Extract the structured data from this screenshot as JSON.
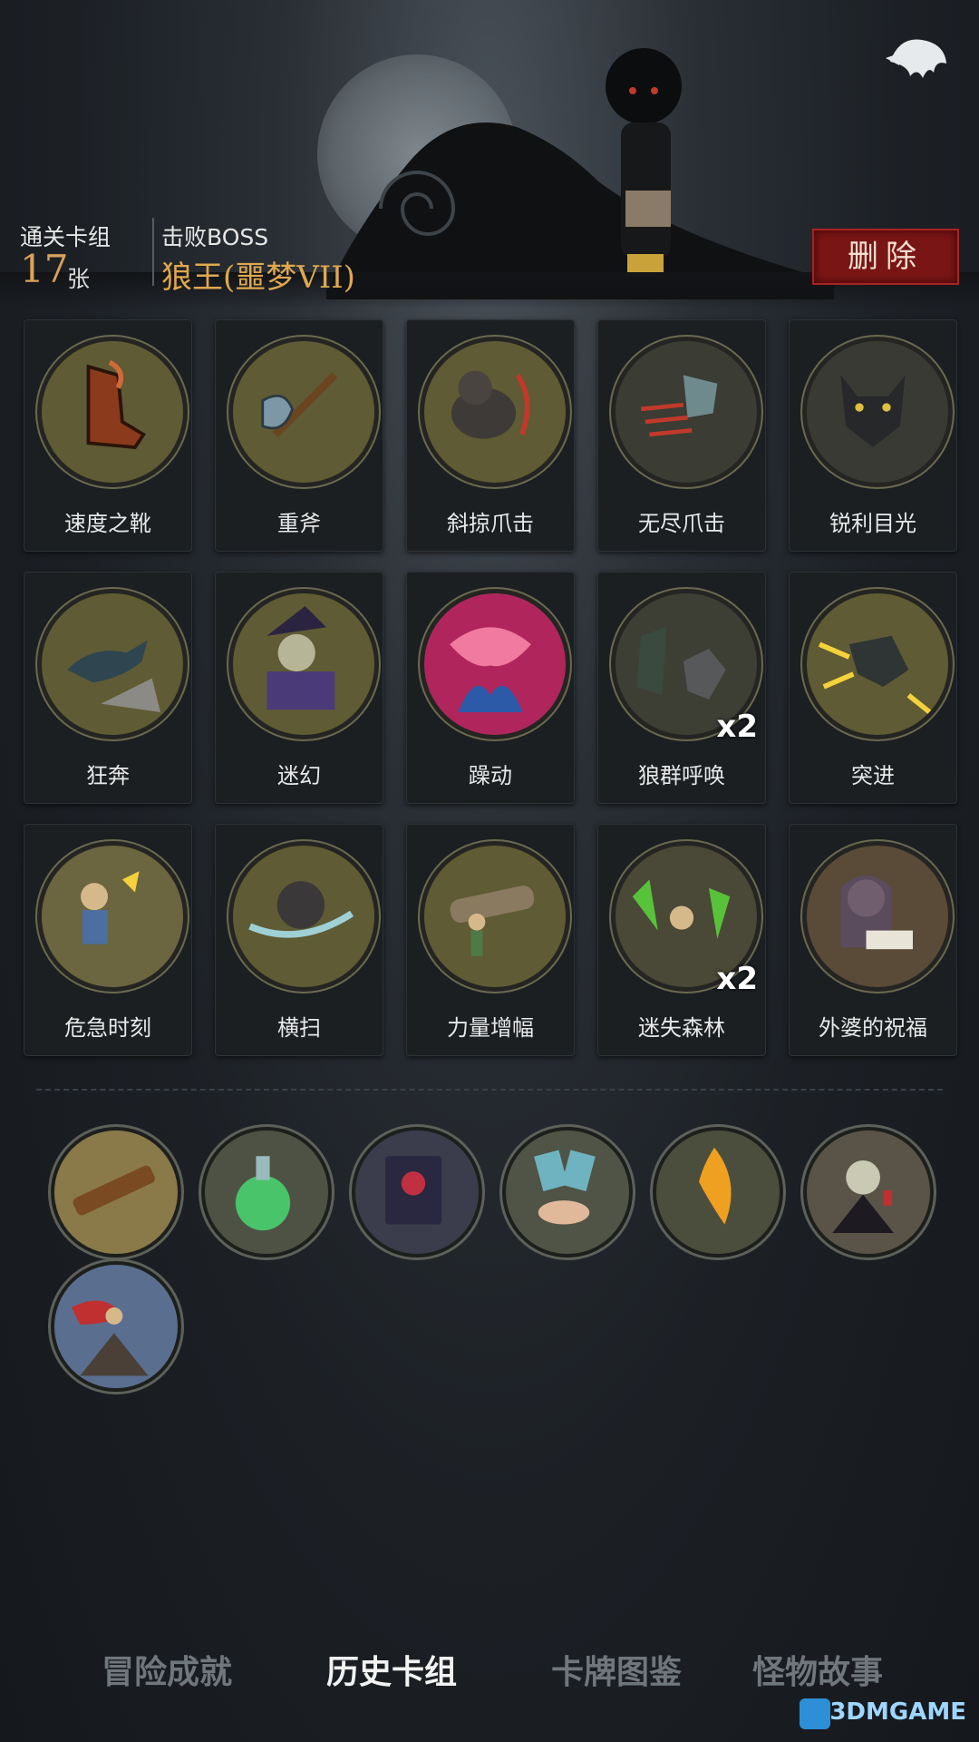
{
  "stats": {
    "deck_label": "通关卡组",
    "deck_count": "17",
    "deck_unit": "张",
    "boss_label": "击败BOSS",
    "boss_name": "狼王(噩梦VII)"
  },
  "delete_label": "删除",
  "cards": [
    {
      "name": "速度之靴",
      "icon": "boot-icon"
    },
    {
      "name": "重斧",
      "icon": "axe-icon"
    },
    {
      "name": "斜掠爪击",
      "icon": "werewolf-slash-icon"
    },
    {
      "name": "无尽爪击",
      "icon": "claw-icon"
    },
    {
      "name": "锐利目光",
      "icon": "wolf-face-icon"
    },
    {
      "name": "狂奔",
      "icon": "running-wolf-icon"
    },
    {
      "name": "迷幻",
      "icon": "witch-icon"
    },
    {
      "name": "躁动",
      "icon": "rage-icon"
    },
    {
      "name": "狼群呼唤",
      "icon": "wolf-pack-icon",
      "badge": "x2"
    },
    {
      "name": "突进",
      "icon": "lunge-icon"
    },
    {
      "name": "危急时刻",
      "icon": "crisis-icon"
    },
    {
      "name": "横扫",
      "icon": "sweep-icon"
    },
    {
      "name": "力量增幅",
      "icon": "log-lift-icon"
    },
    {
      "name": "迷失森林",
      "icon": "lost-forest-icon",
      "badge": "x2"
    },
    {
      "name": "外婆的祝福",
      "icon": "grandma-icon"
    }
  ],
  "relics": [
    {
      "icon": "telescope-icon"
    },
    {
      "icon": "potion-icon"
    },
    {
      "icon": "spellbook-icon"
    },
    {
      "icon": "cards-hand-icon"
    },
    {
      "icon": "flame-feather-icon"
    },
    {
      "icon": "vampire-icon"
    },
    {
      "icon": "hero-cape-icon"
    }
  ],
  "tabs": [
    {
      "label": "冒险成就",
      "active": false
    },
    {
      "label": "历史卡组",
      "active": true
    },
    {
      "label": "卡牌图鉴",
      "active": false
    },
    {
      "label": "怪物故事",
      "active": false
    }
  ],
  "watermark": "3DMGAME",
  "colors": {
    "accent_orange": "#d9a25a",
    "delete_red": "#7a1515",
    "card_bg": "#5f5b34"
  }
}
